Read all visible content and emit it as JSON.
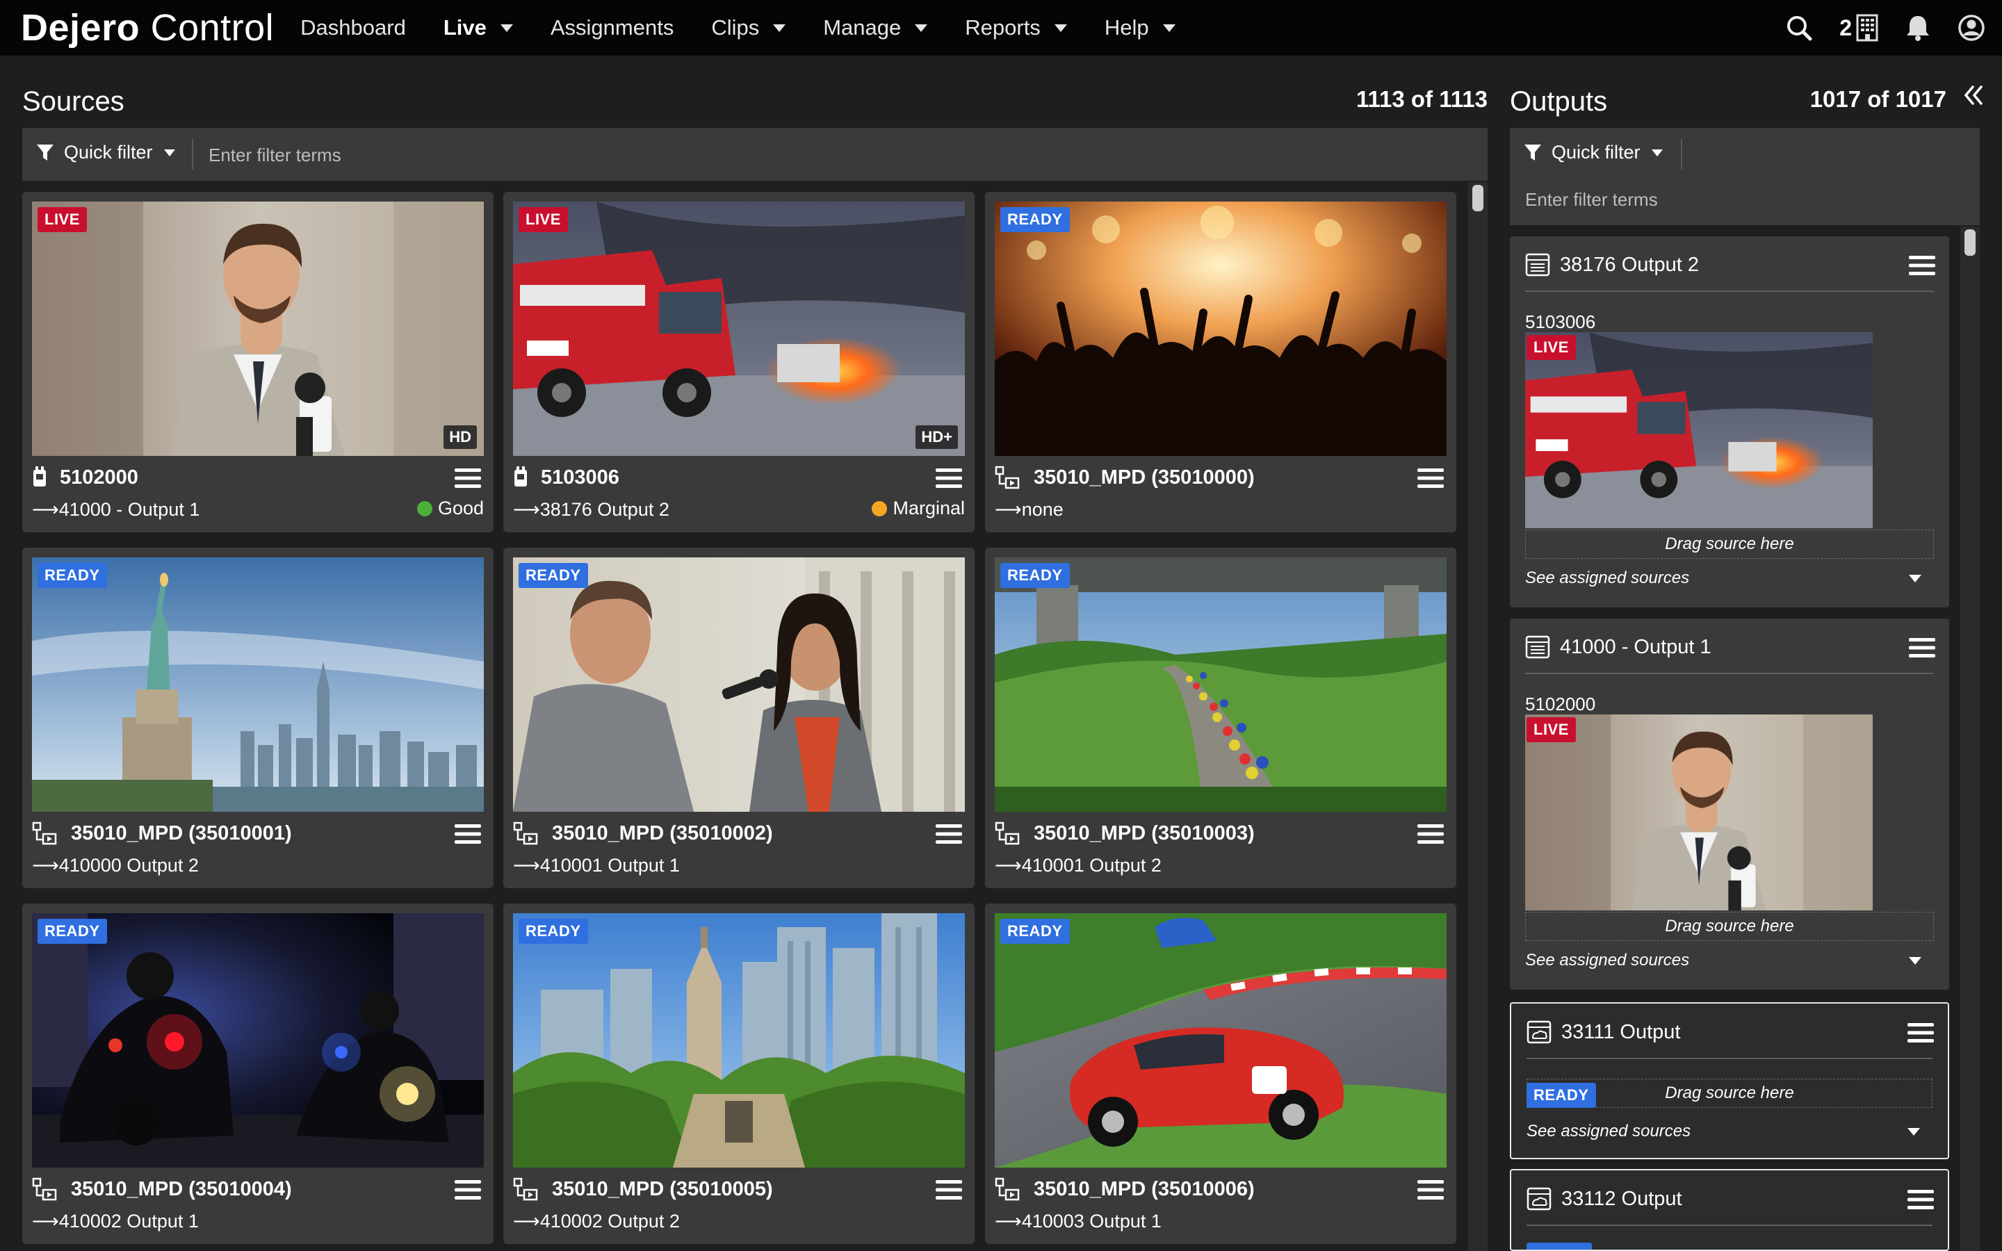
{
  "brand": {
    "bold": "Dejero",
    "light": "Control"
  },
  "nav": [
    {
      "label": "Dashboard",
      "caret": false,
      "active": false
    },
    {
      "label": "Live",
      "caret": true,
      "active": true
    },
    {
      "label": "Assignments",
      "caret": false,
      "active": false
    },
    {
      "label": "Clips",
      "caret": true,
      "active": false
    },
    {
      "label": "Manage",
      "caret": true,
      "active": false
    },
    {
      "label": "Reports",
      "caret": true,
      "active": false
    },
    {
      "label": "Help",
      "caret": true,
      "active": false
    }
  ],
  "topright": {
    "count": "2",
    "icons": [
      "search-icon",
      "building-icon",
      "bell-icon",
      "user-icon"
    ]
  },
  "sources": {
    "title": "Sources",
    "count": "1113 of 1113",
    "quick_filter": "Quick filter",
    "filter_placeholder": "Enter filter terms",
    "cards": [
      {
        "badge": "LIVE",
        "badge_type": "live",
        "res": "HD",
        "name": "5102000",
        "icon": "transmitter-icon",
        "output": "⟶41000 - Output 1",
        "status": "Good",
        "status_color": "#4caf3a",
        "scene": "reporter"
      },
      {
        "badge": "LIVE",
        "badge_type": "live",
        "res": "HD+",
        "name": "5103006",
        "icon": "transmitter-icon",
        "output": "⟶38176 Output 2",
        "status": "Marginal",
        "status_color": "#f5a623",
        "scene": "firetruck"
      },
      {
        "badge": "READY",
        "badge_type": "ready",
        "res": "",
        "name": "35010_MPD (35010000)",
        "icon": "stream-icon",
        "output": "⟶none",
        "status": "",
        "status_color": "",
        "scene": "concert"
      },
      {
        "badge": "READY",
        "badge_type": "ready",
        "res": "",
        "name": "35010_MPD (35010001)",
        "icon": "stream-icon",
        "output": "⟶410000 Output 2",
        "status": "",
        "status_color": "",
        "scene": "liberty"
      },
      {
        "badge": "READY",
        "badge_type": "ready",
        "res": "",
        "name": "35010_MPD (35010002)",
        "icon": "stream-icon",
        "output": "⟶410001 Output 1",
        "status": "",
        "status_color": "",
        "scene": "interview"
      },
      {
        "badge": "READY",
        "badge_type": "ready",
        "res": "",
        "name": "35010_MPD (35010003)",
        "icon": "stream-icon",
        "output": "⟶410001 Output 2",
        "status": "",
        "status_color": "",
        "scene": "cycling"
      },
      {
        "badge": "READY",
        "badge_type": "ready",
        "res": "",
        "name": "35010_MPD (35010004)",
        "icon": "stream-icon",
        "output": "⟶410002 Output 1",
        "status": "",
        "status_color": "",
        "scene": "police"
      },
      {
        "badge": "READY",
        "badge_type": "ready",
        "res": "",
        "name": "35010_MPD (35010005)",
        "icon": "stream-icon",
        "output": "⟶410002 Output 2",
        "status": "",
        "status_color": "",
        "scene": "city"
      },
      {
        "badge": "READY",
        "badge_type": "ready",
        "res": "",
        "name": "35010_MPD (35010006)",
        "icon": "stream-icon",
        "output": "⟶410003 Output 1",
        "status": "",
        "status_color": "",
        "scene": "racecar"
      }
    ]
  },
  "outputs": {
    "title": "Outputs",
    "count": "1017 of 1017",
    "quick_filter": "Quick filter",
    "filter_placeholder": "Enter filter terms",
    "drag_text": "Drag source here",
    "see_text": "See assigned sources",
    "cards": [
      {
        "name": "38176 Output 2",
        "icon": "server-icon",
        "source": "5103006",
        "badge": "LIVE",
        "scene": "firetruck"
      },
      {
        "name": "41000 - Output 1",
        "icon": "server-icon",
        "source": "5102000",
        "badge": "LIVE",
        "scene": "reporter"
      },
      {
        "name": "33111 Output",
        "icon": "cloud-server-icon",
        "source": "",
        "badge": "READY",
        "scene": ""
      },
      {
        "name": "33112 Output",
        "icon": "cloud-server-icon",
        "source": "",
        "badge": "",
        "scene": ""
      }
    ]
  }
}
